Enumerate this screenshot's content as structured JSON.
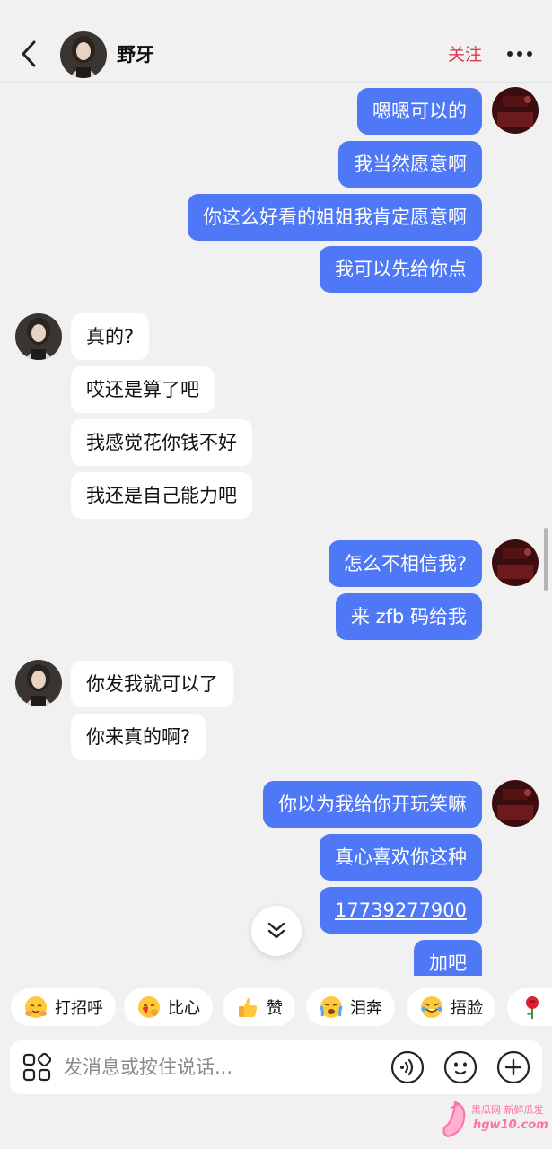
{
  "header": {
    "contact_name": "野牙",
    "follow_label": "关注"
  },
  "messages": [
    {
      "side": "out",
      "text": "嗯嗯可以的"
    },
    {
      "side": "out",
      "text": "我当然愿意啊"
    },
    {
      "side": "out",
      "text": "你这么好看的姐姐我肯定愿意啊"
    },
    {
      "side": "out",
      "text": "我可以先给你点"
    },
    {
      "side": "in",
      "text": "真的?"
    },
    {
      "side": "in",
      "text": "哎还是算了吧"
    },
    {
      "side": "in",
      "text": "我感觉花你钱不好"
    },
    {
      "side": "in",
      "text": "我还是自己能力吧"
    },
    {
      "side": "out",
      "text": "怎么不相信我?"
    },
    {
      "side": "out",
      "text": "来 zfb 码给我"
    },
    {
      "side": "in",
      "text": "你发我就可以了"
    },
    {
      "side": "in",
      "text": "你来真的啊?"
    },
    {
      "side": "out",
      "text": "你以为我给你开玩笑嘛"
    },
    {
      "side": "out",
      "text": "真心喜欢你这种"
    },
    {
      "side": "out",
      "text": "17739277900"
    },
    {
      "side": "out",
      "text": "加吧"
    }
  ],
  "quick_replies": [
    {
      "label": "打招呼",
      "icon": "hug-emoji-icon"
    },
    {
      "label": "比心",
      "icon": "finger-heart-emoji-icon"
    },
    {
      "label": "赞",
      "icon": "thumbs-up-emoji-icon"
    },
    {
      "label": "泪奔",
      "icon": "crying-emoji-icon"
    },
    {
      "label": "捂脸",
      "icon": "facepalm-emoji-icon"
    },
    {
      "label": "",
      "icon": "rose-emoji-icon"
    }
  ],
  "input": {
    "placeholder": "发消息或按住说话..."
  },
  "watermark": {
    "top_text": "黑瓜网 新鲜瓜发",
    "bottom_text": "hgw10.com"
  },
  "colors": {
    "outgoing_bubble": "#4f78f7",
    "incoming_bubble": "#ffffff",
    "follow": "#e0354f",
    "background": "#f1f1f1"
  }
}
